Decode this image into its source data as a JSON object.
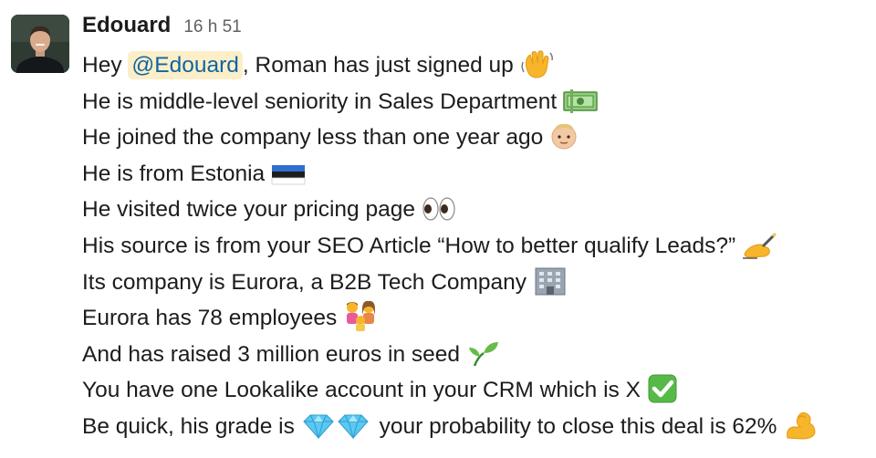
{
  "message": {
    "sender": "Edouard",
    "timestamp": "16 h 51",
    "greeting_prefix": "Hey ",
    "mention": "@Edouard",
    "greeting_suffix": ", Roman has just signed up",
    "lines": [
      "He is middle-level seniority in Sales Department",
      "He joined the company less than one year ago",
      "He is from Estonia",
      "He visited twice your pricing page",
      "His source is from your SEO Article “How to better qualify Leads?”",
      "Its company is Eurora, a B2B Tech Company",
      "Eurora has 78 employees",
      "And has raised 3 million euros in seed",
      "You have one Lookalike account in your CRM which is X",
      "Be quick, his grade is"
    ],
    "grade_suffix": " your probability to close this deal is 62%"
  },
  "emojis": {
    "greeting": "waving-hand",
    "line_0": "money-banknote",
    "line_1": "baby-face",
    "line_2": "estonia-flag",
    "line_3": "eyes",
    "line_4": "writing-hand",
    "line_5": "office-building",
    "line_6": "family",
    "line_7": "seedling",
    "line_8": "check-mark-button",
    "line_9": "gem-stone",
    "last": "flexed-biceps"
  },
  "colors": {
    "mention_bg": "#fcefc8",
    "mention_text": "#1264a3",
    "text": "#1d1c1d",
    "timestamp": "#616061"
  }
}
